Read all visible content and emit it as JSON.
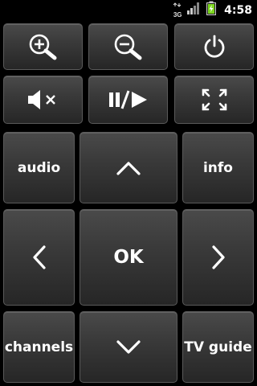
{
  "status_bar": {
    "network_label": "3G",
    "time": "4:58",
    "battery_color": "#7cd61e",
    "icons": [
      "network-3g-icon",
      "signal-icon",
      "battery-charging-icon"
    ]
  },
  "buttons": {
    "zoom_in": {
      "icon": "zoom-in-icon"
    },
    "zoom_out": {
      "icon": "zoom-out-icon"
    },
    "power": {
      "icon": "power-icon"
    },
    "mute": {
      "icon": "mute-icon"
    },
    "play_pause": {
      "icon": "play-pause-icon"
    },
    "fullscreen": {
      "icon": "fullscreen-icon"
    },
    "audio": {
      "label": "audio"
    },
    "up": {
      "icon": "chevron-up-icon"
    },
    "info": {
      "label": "info"
    },
    "left": {
      "icon": "chevron-left-icon"
    },
    "ok": {
      "label": "OK"
    },
    "right": {
      "icon": "chevron-right-icon"
    },
    "channels": {
      "label": "channels"
    },
    "down": {
      "icon": "chevron-down-icon"
    },
    "tv_guide": {
      "label": "TV guide"
    }
  },
  "colors": {
    "background": "#000000",
    "button_top": "#4a4a4a",
    "button_bottom": "#262626",
    "button_border": "#5a5a5a",
    "foreground": "#ffffff"
  }
}
